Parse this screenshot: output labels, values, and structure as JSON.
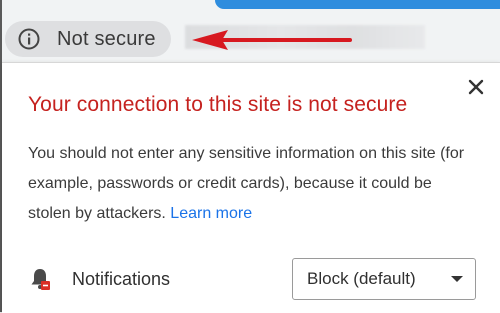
{
  "address_bar": {
    "security_chip_label": "Not secure",
    "icon": "info-icon"
  },
  "annotation": {
    "arrow_color": "#d71920"
  },
  "popup": {
    "title": "Your connection to this site is not secure",
    "description": "You should not enter any sensitive information on this site (for example, passwords or credit cards), because it could be stolen by attackers.",
    "learn_more": "Learn more",
    "close_icon": "close-icon",
    "title_color": "#c5221f",
    "link_color": "#1a73e8",
    "permissions": [
      {
        "icon": "bell-blocked-icon",
        "label": "Notifications",
        "value": "Block (default)"
      }
    ]
  }
}
